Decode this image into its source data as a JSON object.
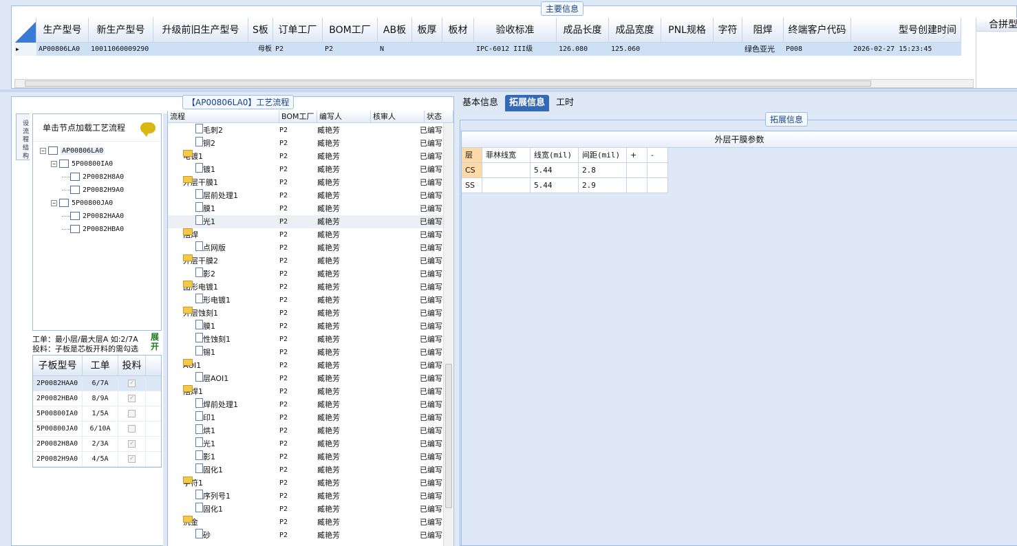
{
  "main_info": {
    "legend": "主要信息",
    "headers": [
      "生产型号",
      "新生产型号",
      "升级前旧生产型号",
      "S板",
      "订单工厂",
      "BOM工厂",
      "AB板",
      "板厚",
      "板材",
      "验收标准",
      "成品长度",
      "成品宽度",
      "PNL规格",
      "字符",
      "阻焊",
      "终端客户代码",
      "型号创建时间"
    ],
    "row": [
      "AP00806LA0",
      "10011060009290",
      "",
      "母板",
      "P2",
      "P2",
      "N",
      "",
      "",
      "IPC-6012 III级",
      "126.080",
      "125.060",
      "",
      "",
      "绿色亚光",
      "P008",
      "2026-02-27 15:23:45"
    ],
    "right_col_header": "合拼型"
  },
  "flow_panel": {
    "legend": "【AP00806LA0】工艺流程",
    "vertical_tab": "设\n流\n程\n结\n构",
    "tree_title": "单击节点加载工艺流程",
    "tree": [
      {
        "label": "AP00806LA0",
        "level": 0
      },
      {
        "label": "5P00800IA0",
        "level": 1
      },
      {
        "label": "2P0082H8A0",
        "level": 2
      },
      {
        "label": "2P0082H9A0",
        "level": 2
      },
      {
        "label": "5P00800JA0",
        "level": 1
      },
      {
        "label": "2P0082HAA0",
        "level": 2
      },
      {
        "label": "2P0082HBA0",
        "level": 2
      }
    ],
    "note_line1": "工单：最小层/最大层A 如:2/7A",
    "note_line2": "投料：子板是芯板开料的需勾选",
    "expand_label": "展\n开",
    "sub_headers": [
      "子板型号",
      "工单",
      "投料"
    ],
    "sub_rows": [
      {
        "model": "2P0082HAA0",
        "order": "6/7A",
        "checked": true
      },
      {
        "model": "2P0082HBA0",
        "order": "8/9A",
        "checked": true
      },
      {
        "model": "5P00800IA0",
        "order": "1/5A",
        "checked": false
      },
      {
        "model": "5P00800JA0",
        "order": "6/10A",
        "checked": false
      },
      {
        "model": "2P0082H8A0",
        "order": "2/3A",
        "checked": true
      },
      {
        "model": "2P0082H9A0",
        "order": "4/5A",
        "checked": true
      }
    ],
    "proc_headers": [
      "流程",
      "BOM工厂",
      "编写人",
      "核审人",
      "状态"
    ],
    "proc_rows": [
      {
        "name": "去毛刺2",
        "level": 1,
        "bom": "P2",
        "author": "臧艳芳",
        "status": "已编写"
      },
      {
        "name": "沉铜2",
        "level": 1,
        "bom": "P2",
        "author": "臧艳芳",
        "status": "已编写"
      },
      {
        "name": "电镀1",
        "level": 0,
        "bom": "P2",
        "author": "臧艳芳",
        "status": "已编写"
      },
      {
        "name": "板镀1",
        "level": 1,
        "bom": "P2",
        "author": "臧艳芳",
        "status": "已编写"
      },
      {
        "name": "外层干膜1",
        "level": 0,
        "bom": "P2",
        "author": "臧艳芳",
        "status": "已编写"
      },
      {
        "name": "外层前处理1",
        "level": 1,
        "bom": "P2",
        "author": "臧艳芳",
        "status": "已编写"
      },
      {
        "name": "贴膜1",
        "level": 1,
        "bom": "P2",
        "author": "臧艳芳",
        "status": "已编写"
      },
      {
        "name": "曝光1",
        "level": 1,
        "bom": "P2",
        "author": "臧艳芳",
        "status": "已编写"
      },
      {
        "name": "阻焊",
        "level": 0,
        "bom": "P2",
        "author": "臧艳芳",
        "status": "已编写"
      },
      {
        "name": "挡点网版",
        "level": 1,
        "bom": "P2",
        "author": "臧艳芳",
        "status": "已编写"
      },
      {
        "name": "外层干膜2",
        "level": 0,
        "bom": "P2",
        "author": "臧艳芳",
        "status": "已编写"
      },
      {
        "name": "显影2",
        "level": 1,
        "bom": "P2",
        "author": "臧艳芳",
        "status": "已编写"
      },
      {
        "name": "图形电镀1",
        "level": 0,
        "bom": "P2",
        "author": "臧艳芳",
        "status": "已编写"
      },
      {
        "name": "图形电镀1",
        "level": 1,
        "bom": "P2",
        "author": "臧艳芳",
        "status": "已编写"
      },
      {
        "name": "外层蚀刻1",
        "level": 0,
        "bom": "P2",
        "author": "臧艳芳",
        "status": "已编写"
      },
      {
        "name": "退膜1",
        "level": 1,
        "bom": "P2",
        "author": "臧艳芳",
        "status": "已编写"
      },
      {
        "name": "碱性蚀刻1",
        "level": 1,
        "bom": "P2",
        "author": "臧艳芳",
        "status": "已编写"
      },
      {
        "name": "退锡1",
        "level": 1,
        "bom": "P2",
        "author": "臧艳芳",
        "status": "已编写"
      },
      {
        "name": "AOI1",
        "level": 0,
        "bom": "P2",
        "author": "臧艳芳",
        "status": "已编写"
      },
      {
        "name": "外层AOI1",
        "level": 1,
        "bom": "P2",
        "author": "臧艳芳",
        "status": "已编写"
      },
      {
        "name": "阻焊1",
        "level": 0,
        "bom": "P2",
        "author": "臧艳芳",
        "status": "已编写"
      },
      {
        "name": "阻焊前处理1",
        "level": 1,
        "bom": "P2",
        "author": "臧艳芳",
        "status": "已编写"
      },
      {
        "name": "丝印1",
        "level": 1,
        "bom": "P2",
        "author": "臧艳芳",
        "status": "已编写"
      },
      {
        "name": "预烘1",
        "level": 1,
        "bom": "P2",
        "author": "臧艳芳",
        "status": "已编写"
      },
      {
        "name": "曝光1",
        "level": 1,
        "bom": "P2",
        "author": "臧艳芳",
        "status": "已编写"
      },
      {
        "name": "显影1",
        "level": 1,
        "bom": "P2",
        "author": "臧艳芳",
        "status": "已编写"
      },
      {
        "name": "终固化1",
        "level": 1,
        "bom": "P2",
        "author": "臧艳芳",
        "status": "已编写"
      },
      {
        "name": "字符1",
        "level": 0,
        "bom": "P2",
        "author": "臧艳芳",
        "status": "已编写"
      },
      {
        "name": "印序列号1",
        "level": 1,
        "bom": "P2",
        "author": "臧艳芳",
        "status": "已编写"
      },
      {
        "name": "终固化1",
        "level": 1,
        "bom": "P2",
        "author": "臧艳芳",
        "status": "已编写"
      },
      {
        "name": "沉金",
        "level": 0,
        "bom": "P2",
        "author": "臧艳芳",
        "status": "已编写"
      },
      {
        "name": "喷砂",
        "level": 1,
        "bom": "P2",
        "author": "臧艳芳",
        "status": "已编写"
      }
    ]
  },
  "right_panel": {
    "tabs": [
      "基本信息",
      "拓展信息",
      "工时"
    ],
    "active_tab": 1,
    "ext_legend": "拓展信息",
    "table_title": "外层干膜参数",
    "headers": [
      "层",
      "菲林线宽",
      "线宽(mil)",
      "间距(mil)",
      "+",
      "-"
    ],
    "rows": [
      {
        "layer": "CS",
        "film": "",
        "width": "5.44",
        "gap": "2.8"
      },
      {
        "layer": "SS",
        "film": "",
        "width": "5.44",
        "gap": "2.9"
      }
    ]
  }
}
